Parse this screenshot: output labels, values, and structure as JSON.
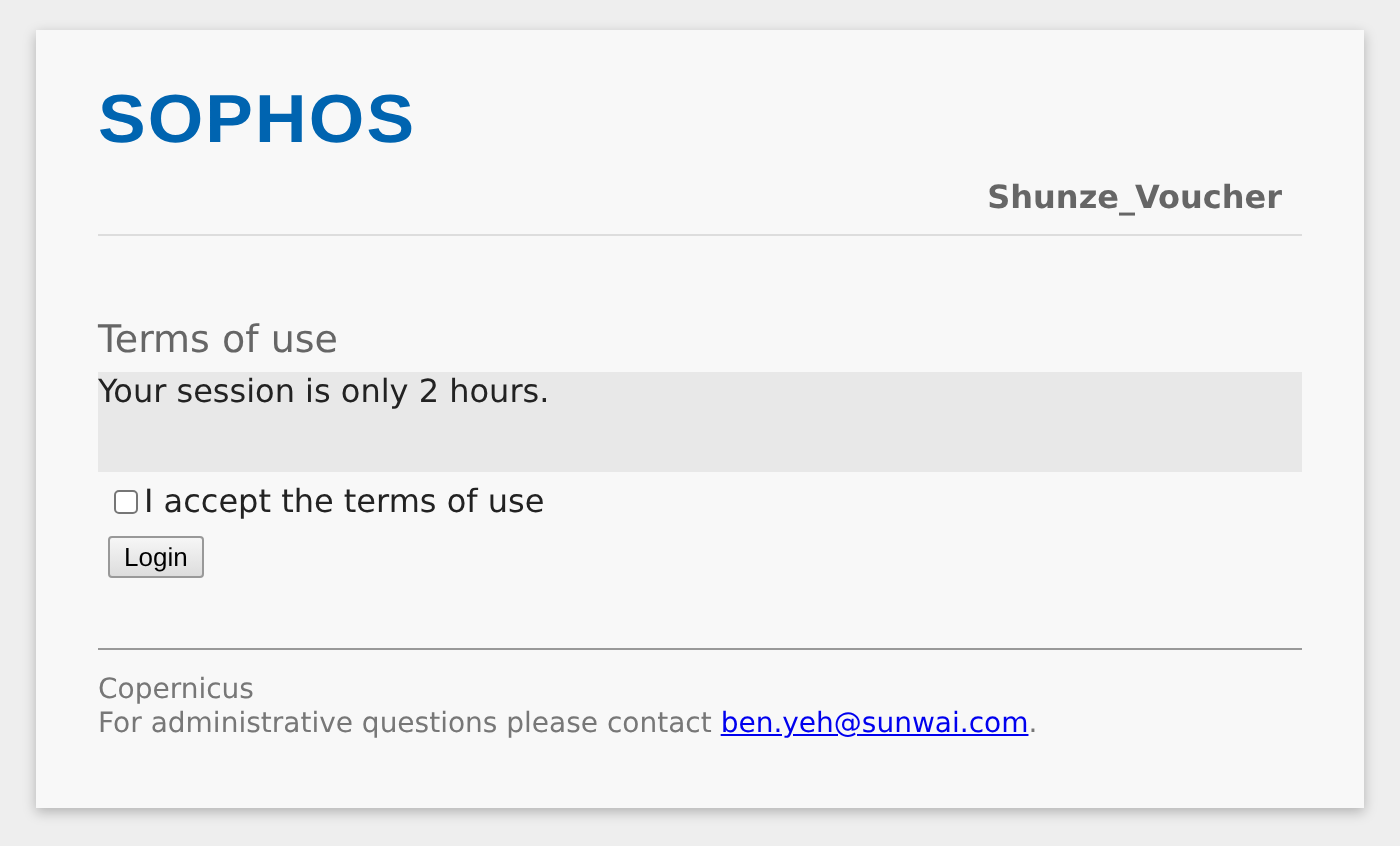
{
  "logo": "SOPHOS",
  "profile": "Shunze_Voucher",
  "terms": {
    "title": "Terms of use",
    "message": "Your session is only 2 hours."
  },
  "accept": {
    "label": "I accept the terms of use",
    "checked": false
  },
  "login_button": "Login",
  "footer": {
    "name": "Copernicus",
    "contact_before": "For administrative questions please contact ",
    "contact_link": "ben.yeh@sunwai.com",
    "contact_after": "."
  }
}
